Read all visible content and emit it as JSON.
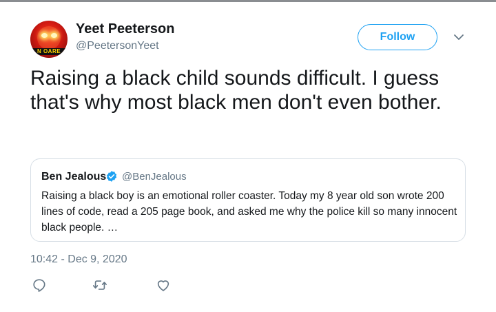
{
  "tweet": {
    "author": {
      "name": "Yeet Peeterson",
      "handle": "@PeetersonYeet",
      "avatar_banner_text": "N OARE"
    },
    "follow_label": "Follow",
    "text": "Raising a black child sounds difficult. I guess that's why most black men don't even bother.",
    "timestamp": "10:42 - Dec 9, 2020",
    "quoted": {
      "name": "Ben Jealous",
      "verified": true,
      "handle": "@BenJealous",
      "text": "Raising a black boy is an emotional roller coaster. Today my 8 year old son wrote 200 lines of code, read a 205 page book, and asked me why the police kill so many innocent black people. …"
    },
    "actions": [
      "reply-icon",
      "retweet-icon",
      "like-icon"
    ]
  },
  "colors": {
    "accent": "#1da1f2",
    "secondary_text": "#657786",
    "border": "#d7dfe6"
  }
}
